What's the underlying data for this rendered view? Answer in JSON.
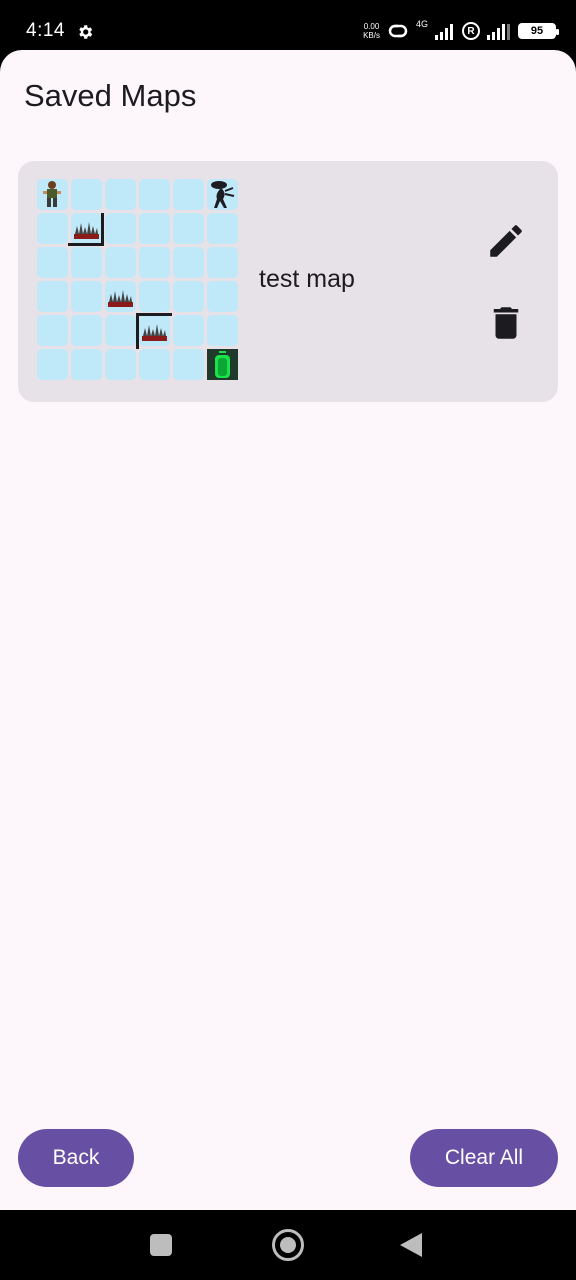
{
  "status_bar": {
    "time": "4:14",
    "net_speed_value": "0.00",
    "net_speed_unit": "KB/s",
    "network_type": "4G",
    "roaming": "R",
    "battery": "95"
  },
  "page": {
    "title": "Saved Maps"
  },
  "maps": [
    {
      "name": "test map",
      "grid_size": [
        6,
        6
      ],
      "sprites": [
        {
          "type": "player-icon",
          "row": 0,
          "col": 0
        },
        {
          "type": "alien-icon",
          "row": 0,
          "col": 5
        },
        {
          "type": "spikes-icon",
          "row": 1,
          "col": 1
        },
        {
          "type": "spikes-icon",
          "row": 3,
          "col": 2
        },
        {
          "type": "spikes-icon",
          "row": 4,
          "col": 3
        },
        {
          "type": "exit-door-icon",
          "row": 5,
          "col": 5
        }
      ],
      "edit_icon": "pencil-icon",
      "delete_icon": "trash-icon"
    }
  ],
  "footer": {
    "back_label": "Back",
    "clear_all_label": "Clear All"
  },
  "colors": {
    "primary": "#6750a4",
    "card": "#e7e1e8",
    "cell": "#bfe8f9",
    "background": "#fdf7fc"
  }
}
